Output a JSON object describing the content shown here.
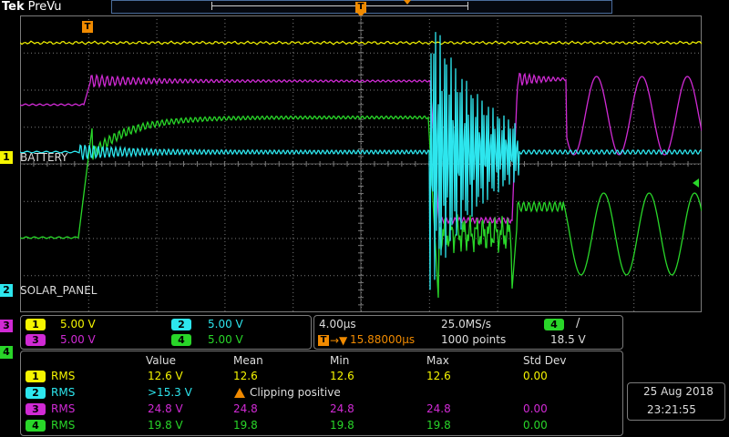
{
  "header": {
    "brand": "Tek",
    "mode": "PreVu",
    "trigger_glyph": "T"
  },
  "colors": {
    "ch1": "#f5f500",
    "ch2": "#2de6ee",
    "ch3": "#d02ad4",
    "ch4": "#29d629",
    "trigger": "#f08a00",
    "graticule": "#7a7a7a"
  },
  "channels": {
    "ch1": {
      "number": "1",
      "label": "BATTERY",
      "scale": "5.00 V"
    },
    "ch2": {
      "number": "2",
      "label": "SOLAR_PANEL",
      "scale": "5.00 V"
    },
    "ch3": {
      "number": "3",
      "scale": "5.00 V"
    },
    "ch4": {
      "number": "4",
      "scale": "5.00 V"
    }
  },
  "horizontal": {
    "time_per_div": "4.00µs",
    "sample_rate": "25.0MS/s",
    "trigger_position": "15.88000µs",
    "record_length": "1000 points",
    "trigger_source": "4",
    "trigger_slope": "/",
    "trigger_level": "18.5 V"
  },
  "measurements": {
    "headers": [
      "Value",
      "Mean",
      "Min",
      "Max",
      "Std Dev"
    ],
    "rows": [
      {
        "channel": "1",
        "type": "RMS",
        "value": "12.6 V",
        "mean": "12.6",
        "min": "12.6",
        "max": "12.6",
        "std_dev": "0.00"
      },
      {
        "channel": "2",
        "type": "RMS",
        "value": ">15.3 V",
        "warning": "Clipping positive"
      },
      {
        "channel": "3",
        "type": "RMS",
        "value": "24.8 V",
        "mean": "24.8",
        "min": "24.8",
        "max": "24.8",
        "std_dev": "0.00"
      },
      {
        "channel": "4",
        "type": "RMS",
        "value": "19.8 V",
        "mean": "19.8",
        "min": "19.8",
        "max": "19.8",
        "std_dev": "0.00"
      }
    ]
  },
  "timestamp": {
    "date": "25 Aug 2018",
    "time": "23:21:55"
  }
}
